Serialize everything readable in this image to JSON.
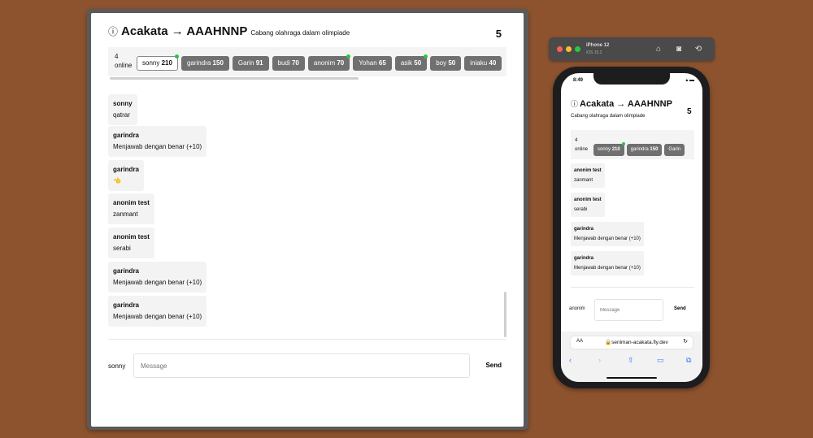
{
  "app": {
    "title": "Acakata → AAAHNNP",
    "subtitle": "Cabang olahraga dalam olimpiade",
    "count": "5"
  },
  "desktop": {
    "online_count": "4",
    "online_label": "online",
    "players": [
      {
        "name": "sonny",
        "score": "210",
        "active": true,
        "online": true
      },
      {
        "name": "garindra",
        "score": "150",
        "online": false
      },
      {
        "name": "Garin",
        "score": "91",
        "online": false
      },
      {
        "name": "budi",
        "score": "70",
        "online": false
      },
      {
        "name": "anonim",
        "score": "70",
        "online": true
      },
      {
        "name": "Yohan",
        "score": "65",
        "online": false
      },
      {
        "name": "asik",
        "score": "50",
        "online": true
      },
      {
        "name": "boy",
        "score": "50",
        "online": false
      },
      {
        "name": "iniaku",
        "score": "40",
        "online": false
      }
    ],
    "messages": [
      {
        "from": "sonny",
        "text": "qatrar"
      },
      {
        "from": "garindra",
        "text": "Menjawab dengan benar (+10)"
      },
      {
        "from": "garindra",
        "text": "👈"
      },
      {
        "from": "anonim test",
        "text": "zanmant"
      },
      {
        "from": "anonim test",
        "text": "serabi"
      },
      {
        "from": "garindra",
        "text": "Menjawab dengan benar (+10)"
      },
      {
        "from": "garindra",
        "text": "Menjawab dengan benar (+10)"
      }
    ],
    "compose": {
      "user": "sonny",
      "placeholder": "Message",
      "send_label": "Send"
    }
  },
  "simulator": {
    "device_name": "iPhone 12",
    "os_version": "iOS 15.2"
  },
  "phone": {
    "time": "8:49",
    "online_count": "4",
    "online_label": "online",
    "players": [
      {
        "name": "sonny",
        "score": "210",
        "online": true
      },
      {
        "name": "garindra",
        "score": "150",
        "online": false
      },
      {
        "name": "Garin",
        "score": "",
        "online": false
      }
    ],
    "messages": [
      {
        "from": "anonim test",
        "text": "zanmant"
      },
      {
        "from": "anonim test",
        "text": "serabi"
      },
      {
        "from": "garindra",
        "text": "Menjawab dengan benar (+10)"
      },
      {
        "from": "garindra",
        "text": "Menjawab dengan benar (+10)"
      }
    ],
    "compose": {
      "user": "anonim",
      "placeholder": "Message",
      "send_label": "Send"
    },
    "safari": {
      "aa_label": "AA",
      "url": "seniman-acakata.fly.dev"
    }
  }
}
